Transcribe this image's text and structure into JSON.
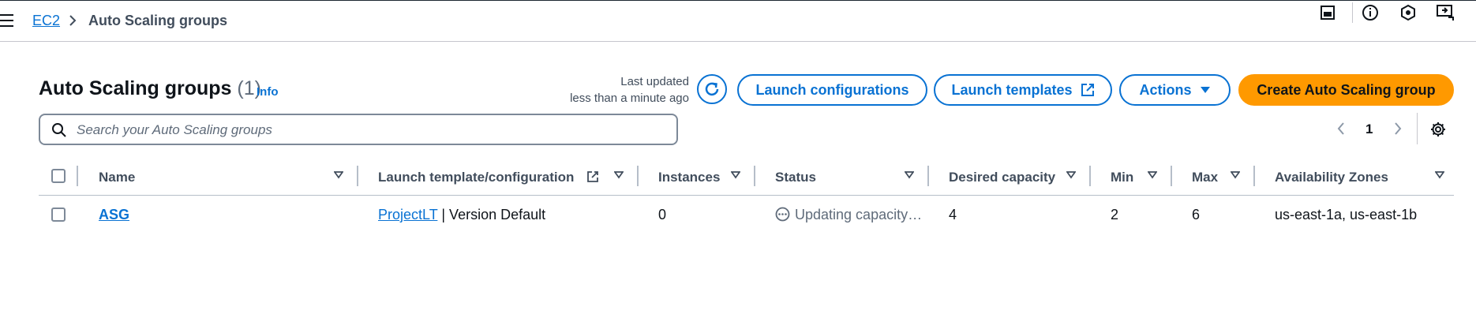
{
  "breadcrumb": {
    "root": "EC2",
    "current": "Auto Scaling groups"
  },
  "icons": [
    "menu-icon",
    "chevron-right-icon",
    "panel-icon",
    "info-icon",
    "hexagon-icon",
    "screen-share-icon",
    "refresh-icon",
    "external-link-icon",
    "caret-down-icon",
    "search-icon",
    "chevron-left-icon",
    "settings-icon",
    "sort-icon",
    "status-in-progress-icon"
  ],
  "header": {
    "title": "Auto Scaling groups",
    "count": "(1)",
    "info": "Info",
    "last_updated_line1": "Last updated",
    "last_updated_line2": "less than a minute ago"
  },
  "buttons": {
    "launch_configurations": "Launch configurations",
    "launch_templates": "Launch templates",
    "actions": "Actions",
    "create": "Create Auto Scaling group"
  },
  "search": {
    "placeholder": "Search your Auto Scaling groups",
    "value": ""
  },
  "pagination": {
    "current_page": "1"
  },
  "table": {
    "columns": [
      "Name",
      "Launch template/configuration",
      "Instances",
      "Status",
      "Desired capacity",
      "Min",
      "Max",
      "Availability Zones"
    ],
    "rows": [
      {
        "name": "ASG",
        "launch_template": "ProjectLT",
        "launch_version": " | Version Default",
        "instances": "0",
        "status": "Updating capacity…",
        "desired_capacity": "4",
        "min": "2",
        "max": "6",
        "availability_zones": "us-east-1a, us-east-1b"
      }
    ]
  },
  "colors": {
    "accent": "#0972d3",
    "primary_button": "#ff9900",
    "text": "#0f141a",
    "muted": "#5f6b7a"
  }
}
